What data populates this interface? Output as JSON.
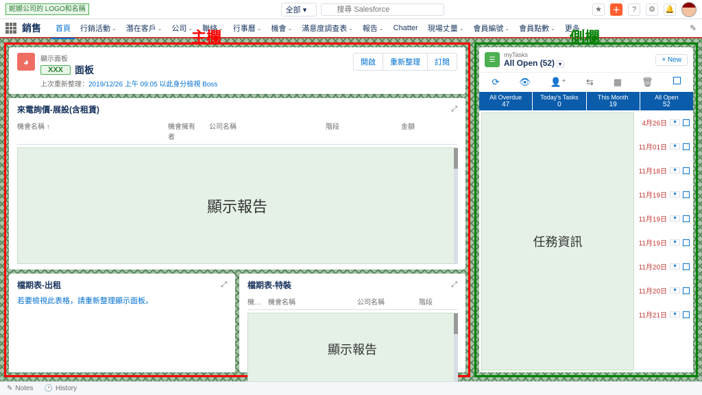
{
  "logo": "妮娜公司的\nLOGO和名稱",
  "search": {
    "scope": "全部",
    "placeholder": "搜尋 Salesforce"
  },
  "app_name": "銷售",
  "nav": [
    {
      "label": "首頁",
      "active": true,
      "chev": false
    },
    {
      "label": "行銷活動",
      "chev": true
    },
    {
      "label": "潛在客戶",
      "chev": true
    },
    {
      "label": "公司",
      "chev": true
    },
    {
      "label": "聯絡",
      "chev": true
    },
    {
      "label": "行事曆",
      "chev": true
    },
    {
      "label": "機會",
      "chev": true
    },
    {
      "label": "滿意度調查表",
      "chev": true
    },
    {
      "label": "報告",
      "chev": true
    },
    {
      "label": "Chatter",
      "chev": false
    },
    {
      "label": "現場丈量",
      "chev": true
    },
    {
      "label": "會員編號",
      "chev": true
    },
    {
      "label": "會員點數",
      "chev": true
    },
    {
      "label": "更多",
      "chev": true
    }
  ],
  "annotations": {
    "main": "主欄",
    "side": "側欄"
  },
  "dashboard": {
    "eyebrow": "顯示面板",
    "tag": "XXX",
    "title_suffix": "面板",
    "meta_prefix": "上次重新整理：",
    "meta_link": "2019/12/26 上午 09:05 以此身分檢視 Boss",
    "actions": [
      "開啟",
      "重新整理",
      "訂閱"
    ]
  },
  "report1": {
    "title": "來電詢價-展設(含租賃)",
    "cols": [
      "機會名稱 ↑",
      "機會擁有者",
      "公司名稱",
      "階段",
      "金額"
    ],
    "body": "顯示報告"
  },
  "report2": {
    "title": "檔期表-出租",
    "msg": "若要檢視此表格，請重新整理顯示面板。"
  },
  "report3": {
    "title": "檔期表-特裝",
    "cols": [
      "機…",
      "機會名稱",
      "公司名稱",
      "階段"
    ],
    "body": "顯示報告"
  },
  "side": {
    "eyebrow": "myTasks",
    "title": "All Open (52)",
    "new": "New",
    "tabs": [
      {
        "label": "All Overdue",
        "count": "47"
      },
      {
        "label": "Today's Tasks",
        "count": "0"
      },
      {
        "label": "This Month",
        "count": "19"
      },
      {
        "label": "All Open",
        "count": "52"
      }
    ],
    "info": "任務資訊",
    "dates": [
      "4月26日",
      "11月01日",
      "11月18日",
      "11月19日",
      "11月19日",
      "11月19日",
      "11月20日",
      "11月20日",
      "11月21日"
    ]
  },
  "footer": {
    "notes": "Notes",
    "history": "History"
  }
}
